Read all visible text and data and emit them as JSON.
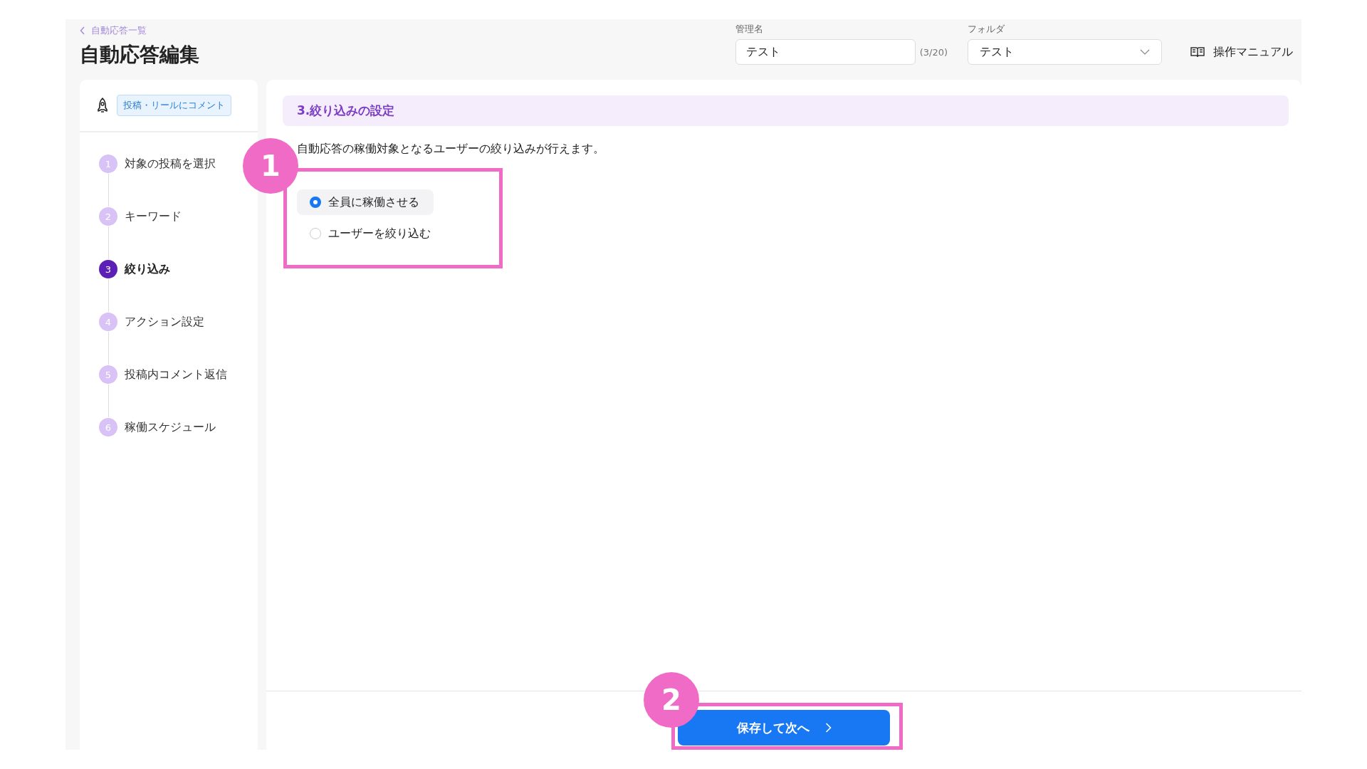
{
  "header": {
    "back_link": "自動応答一覧",
    "title": "自動応答編集",
    "name_field": {
      "label": "管理名",
      "value": "テスト",
      "counter": "(3/20)"
    },
    "folder_field": {
      "label": "フォルダ",
      "value": "テスト"
    },
    "manual_link": "操作マニュアル"
  },
  "sidebar": {
    "trigger_tag": "投稿・リールにコメント",
    "steps": [
      {
        "number": "1",
        "label": "対象の投稿を選択",
        "selected": false
      },
      {
        "number": "2",
        "label": "キーワード",
        "selected": false
      },
      {
        "number": "3",
        "label": "絞り込み",
        "selected": true
      },
      {
        "number": "4",
        "label": "アクション設定",
        "selected": false
      },
      {
        "number": "5",
        "label": "投稿内コメント返信",
        "selected": false
      },
      {
        "number": "6",
        "label": "稼働スケジュール",
        "selected": false
      }
    ]
  },
  "section": {
    "title": "3.絞り込みの設定",
    "description": "自動応答の稼働対象となるユーザーの絞り込みが行えます。",
    "options": [
      {
        "label": "全員に稼働させる",
        "selected": true
      },
      {
        "label": "ユーザーを絞り込む",
        "selected": false
      }
    ]
  },
  "footer": {
    "save_button": "保存して次へ"
  },
  "annotations": [
    {
      "number": "1"
    },
    {
      "number": "2"
    }
  ]
}
